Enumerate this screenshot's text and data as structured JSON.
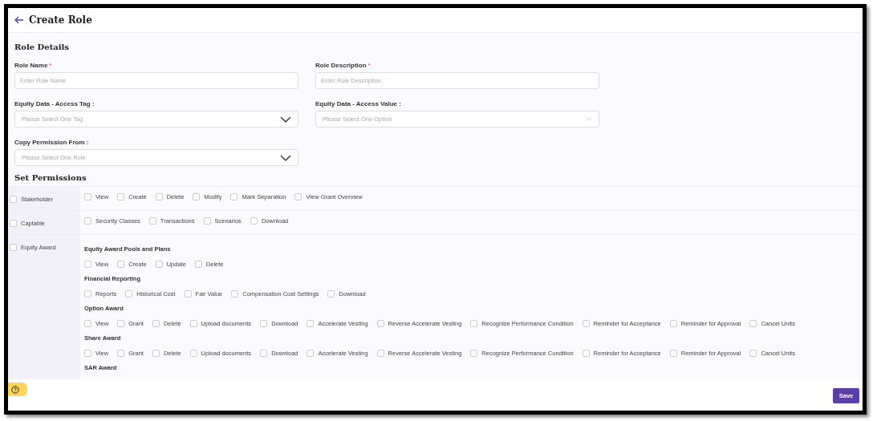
{
  "header": {
    "title": "Create Role"
  },
  "role_details": {
    "title": "Role Details",
    "fields": [
      {
        "label": "Role Name",
        "required_mark": "*",
        "kind": "text",
        "placeholder": "Enter Role Name"
      },
      {
        "label": "Role Description",
        "required_mark": "*",
        "kind": "text",
        "placeholder": "Enter Role Description"
      },
      {
        "label": "Equity Data - Access Tag :",
        "kind": "select",
        "disabled": false,
        "placeholder": "Please Select One Tag"
      },
      {
        "label": "Equity Data - Access Value :",
        "kind": "select",
        "disabled": true,
        "placeholder": "Please Select One Option"
      },
      {
        "label": "Copy Permission From :",
        "kind": "select",
        "disabled": false,
        "placeholder": "Please Select One Role"
      }
    ]
  },
  "permissions": {
    "title": "Set Permissions",
    "modules": [
      {
        "name": "Stakeholder",
        "checked": false,
        "kind": "flat",
        "options": [
          {
            "label": "View",
            "checked": false
          },
          {
            "label": "Create",
            "checked": false
          },
          {
            "label": "Delete",
            "checked": false
          },
          {
            "label": "Modify",
            "checked": false
          },
          {
            "label": "Mark Separation",
            "checked": false
          },
          {
            "label": "View Grant Overview",
            "checked": false
          }
        ]
      },
      {
        "name": "Captable",
        "checked": false,
        "kind": "flat",
        "options": [
          {
            "label": "Security Classes",
            "checked": false
          },
          {
            "label": "Transactions",
            "checked": false
          },
          {
            "label": "Scenarios",
            "checked": false
          },
          {
            "label": "Download",
            "checked": false
          }
        ]
      },
      {
        "name": "Equity Award",
        "checked": false,
        "kind": "grouped",
        "groups": [
          {
            "title": "Equity Award Pools and Plans",
            "options": [
              {
                "label": "View",
                "checked": false
              },
              {
                "label": "Create",
                "checked": false
              },
              {
                "label": "Update",
                "checked": false
              },
              {
                "label": "Delete",
                "checked": false
              }
            ]
          },
          {
            "title": "Financial Reporting",
            "options": [
              {
                "label": "Reports",
                "checked": false
              },
              {
                "label": "Historical Cost",
                "checked": false
              },
              {
                "label": "Fair Value",
                "checked": false
              },
              {
                "label": "Compensation Cost Settings",
                "checked": false
              },
              {
                "label": "Download",
                "checked": false
              }
            ]
          },
          {
            "title": "Option Award",
            "options": [
              {
                "label": "View",
                "checked": false
              },
              {
                "label": "Grant",
                "checked": false
              },
              {
                "label": "Delete",
                "checked": false
              },
              {
                "label": "Upload documents",
                "checked": false
              },
              {
                "label": "Download",
                "checked": false
              },
              {
                "label": "Accelerate Vesting",
                "checked": false
              },
              {
                "label": "Reverse Accelerate Vesting",
                "checked": false
              },
              {
                "label": "Recognize Performance Condition",
                "checked": false
              },
              {
                "label": "Reminder for Acceptance",
                "checked": false
              },
              {
                "label": "Reminder for Approval",
                "checked": false
              },
              {
                "label": "Cancel Units",
                "checked": false
              }
            ]
          },
          {
            "title": "Share Award",
            "options": [
              {
                "label": "View",
                "checked": false
              },
              {
                "label": "Grant",
                "checked": false
              },
              {
                "label": "Delete",
                "checked": false
              },
              {
                "label": "Upload documents",
                "checked": false
              },
              {
                "label": "Download",
                "checked": false
              },
              {
                "label": "Accelerate Vesting",
                "checked": false
              },
              {
                "label": "Reverse Accelerate Vesting",
                "checked": false
              },
              {
                "label": "Recognize Performance Condition",
                "checked": false
              },
              {
                "label": "Reminder for Acceptance",
                "checked": false
              },
              {
                "label": "Reminder for Approval",
                "checked": false
              },
              {
                "label": "Cancel Units",
                "checked": false
              }
            ]
          },
          {
            "title": "SAR Award"
          }
        ]
      }
    ]
  },
  "footer": {
    "save": "Save"
  }
}
